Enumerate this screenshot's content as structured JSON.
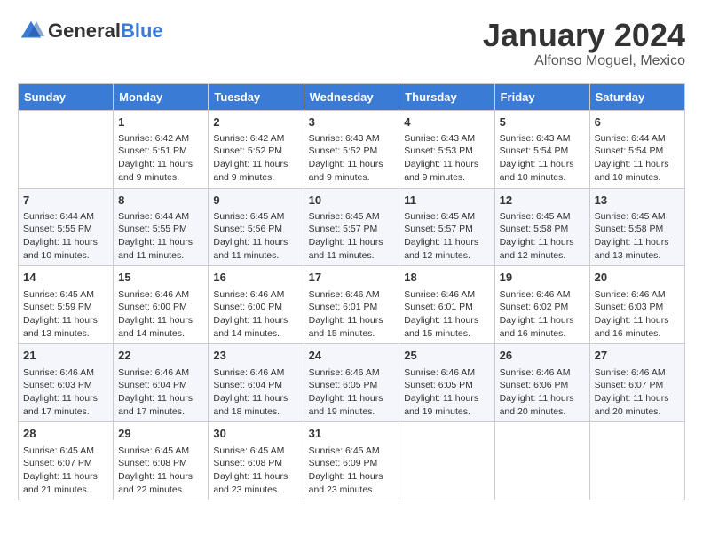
{
  "header": {
    "logo_general": "General",
    "logo_blue": "Blue",
    "title": "January 2024",
    "location": "Alfonso Moguel, Mexico"
  },
  "calendar": {
    "days_of_week": [
      "Sunday",
      "Monday",
      "Tuesday",
      "Wednesday",
      "Thursday",
      "Friday",
      "Saturday"
    ],
    "weeks": [
      [
        {
          "num": "",
          "info": ""
        },
        {
          "num": "1",
          "info": "Sunrise: 6:42 AM\nSunset: 5:51 PM\nDaylight: 11 hours and 9 minutes."
        },
        {
          "num": "2",
          "info": "Sunrise: 6:42 AM\nSunset: 5:52 PM\nDaylight: 11 hours and 9 minutes."
        },
        {
          "num": "3",
          "info": "Sunrise: 6:43 AM\nSunset: 5:52 PM\nDaylight: 11 hours and 9 minutes."
        },
        {
          "num": "4",
          "info": "Sunrise: 6:43 AM\nSunset: 5:53 PM\nDaylight: 11 hours and 9 minutes."
        },
        {
          "num": "5",
          "info": "Sunrise: 6:43 AM\nSunset: 5:54 PM\nDaylight: 11 hours and 10 minutes."
        },
        {
          "num": "6",
          "info": "Sunrise: 6:44 AM\nSunset: 5:54 PM\nDaylight: 11 hours and 10 minutes."
        }
      ],
      [
        {
          "num": "7",
          "info": "Sunrise: 6:44 AM\nSunset: 5:55 PM\nDaylight: 11 hours and 10 minutes."
        },
        {
          "num": "8",
          "info": "Sunrise: 6:44 AM\nSunset: 5:55 PM\nDaylight: 11 hours and 11 minutes."
        },
        {
          "num": "9",
          "info": "Sunrise: 6:45 AM\nSunset: 5:56 PM\nDaylight: 11 hours and 11 minutes."
        },
        {
          "num": "10",
          "info": "Sunrise: 6:45 AM\nSunset: 5:57 PM\nDaylight: 11 hours and 11 minutes."
        },
        {
          "num": "11",
          "info": "Sunrise: 6:45 AM\nSunset: 5:57 PM\nDaylight: 11 hours and 12 minutes."
        },
        {
          "num": "12",
          "info": "Sunrise: 6:45 AM\nSunset: 5:58 PM\nDaylight: 11 hours and 12 minutes."
        },
        {
          "num": "13",
          "info": "Sunrise: 6:45 AM\nSunset: 5:58 PM\nDaylight: 11 hours and 13 minutes."
        }
      ],
      [
        {
          "num": "14",
          "info": "Sunrise: 6:45 AM\nSunset: 5:59 PM\nDaylight: 11 hours and 13 minutes."
        },
        {
          "num": "15",
          "info": "Sunrise: 6:46 AM\nSunset: 6:00 PM\nDaylight: 11 hours and 14 minutes."
        },
        {
          "num": "16",
          "info": "Sunrise: 6:46 AM\nSunset: 6:00 PM\nDaylight: 11 hours and 14 minutes."
        },
        {
          "num": "17",
          "info": "Sunrise: 6:46 AM\nSunset: 6:01 PM\nDaylight: 11 hours and 15 minutes."
        },
        {
          "num": "18",
          "info": "Sunrise: 6:46 AM\nSunset: 6:01 PM\nDaylight: 11 hours and 15 minutes."
        },
        {
          "num": "19",
          "info": "Sunrise: 6:46 AM\nSunset: 6:02 PM\nDaylight: 11 hours and 16 minutes."
        },
        {
          "num": "20",
          "info": "Sunrise: 6:46 AM\nSunset: 6:03 PM\nDaylight: 11 hours and 16 minutes."
        }
      ],
      [
        {
          "num": "21",
          "info": "Sunrise: 6:46 AM\nSunset: 6:03 PM\nDaylight: 11 hours and 17 minutes."
        },
        {
          "num": "22",
          "info": "Sunrise: 6:46 AM\nSunset: 6:04 PM\nDaylight: 11 hours and 17 minutes."
        },
        {
          "num": "23",
          "info": "Sunrise: 6:46 AM\nSunset: 6:04 PM\nDaylight: 11 hours and 18 minutes."
        },
        {
          "num": "24",
          "info": "Sunrise: 6:46 AM\nSunset: 6:05 PM\nDaylight: 11 hours and 19 minutes."
        },
        {
          "num": "25",
          "info": "Sunrise: 6:46 AM\nSunset: 6:05 PM\nDaylight: 11 hours and 19 minutes."
        },
        {
          "num": "26",
          "info": "Sunrise: 6:46 AM\nSunset: 6:06 PM\nDaylight: 11 hours and 20 minutes."
        },
        {
          "num": "27",
          "info": "Sunrise: 6:46 AM\nSunset: 6:07 PM\nDaylight: 11 hours and 20 minutes."
        }
      ],
      [
        {
          "num": "28",
          "info": "Sunrise: 6:45 AM\nSunset: 6:07 PM\nDaylight: 11 hours and 21 minutes."
        },
        {
          "num": "29",
          "info": "Sunrise: 6:45 AM\nSunset: 6:08 PM\nDaylight: 11 hours and 22 minutes."
        },
        {
          "num": "30",
          "info": "Sunrise: 6:45 AM\nSunset: 6:08 PM\nDaylight: 11 hours and 23 minutes."
        },
        {
          "num": "31",
          "info": "Sunrise: 6:45 AM\nSunset: 6:09 PM\nDaylight: 11 hours and 23 minutes."
        },
        {
          "num": "",
          "info": ""
        },
        {
          "num": "",
          "info": ""
        },
        {
          "num": "",
          "info": ""
        }
      ]
    ]
  }
}
